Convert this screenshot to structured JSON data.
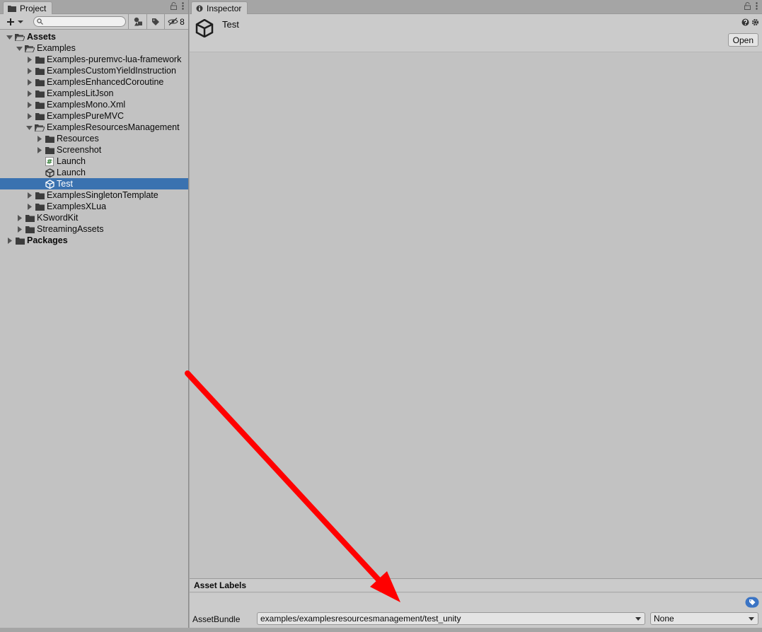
{
  "project": {
    "tab_label": "Project",
    "search_placeholder": "",
    "hidden_count": "8",
    "tree": [
      {
        "label": "Assets",
        "depth": 0,
        "arrow": "open",
        "icon": "folder-open",
        "bold": true
      },
      {
        "label": "Examples",
        "depth": 1,
        "arrow": "open",
        "icon": "folder-open"
      },
      {
        "label": "Examples-puremvc-lua-framework",
        "depth": 2,
        "arrow": "closed",
        "icon": "folder"
      },
      {
        "label": "ExamplesCustomYieldInstruction",
        "depth": 2,
        "arrow": "closed",
        "icon": "folder"
      },
      {
        "label": "ExamplesEnhancedCoroutine",
        "depth": 2,
        "arrow": "closed",
        "icon": "folder"
      },
      {
        "label": "ExamplesLitJson",
        "depth": 2,
        "arrow": "closed",
        "icon": "folder"
      },
      {
        "label": "ExamplesMono.Xml",
        "depth": 2,
        "arrow": "closed",
        "icon": "folder"
      },
      {
        "label": "ExamplesPureMVC",
        "depth": 2,
        "arrow": "closed",
        "icon": "folder"
      },
      {
        "label": "ExamplesResourcesManagement",
        "depth": 2,
        "arrow": "open",
        "icon": "folder-open"
      },
      {
        "label": "Resources",
        "depth": 3,
        "arrow": "closed",
        "icon": "folder"
      },
      {
        "label": "Screenshot",
        "depth": 3,
        "arrow": "closed",
        "icon": "folder"
      },
      {
        "label": "Launch",
        "depth": 3,
        "arrow": "none",
        "icon": "csharp"
      },
      {
        "label": "Launch",
        "depth": 3,
        "arrow": "none",
        "icon": "unity"
      },
      {
        "label": "Test",
        "depth": 3,
        "arrow": "none",
        "icon": "unity",
        "selected": true
      },
      {
        "label": "ExamplesSingletonTemplate",
        "depth": 2,
        "arrow": "closed",
        "icon": "folder"
      },
      {
        "label": "ExamplesXLua",
        "depth": 2,
        "arrow": "closed",
        "icon": "folder"
      },
      {
        "label": "KSwordKit",
        "depth": 1,
        "arrow": "closed",
        "icon": "folder"
      },
      {
        "label": "StreamingAssets",
        "depth": 1,
        "arrow": "closed",
        "icon": "folder"
      },
      {
        "label": "Packages",
        "depth": 0,
        "arrow": "closed",
        "icon": "folder",
        "bold": true
      }
    ]
  },
  "inspector": {
    "tab_label": "Inspector",
    "asset_title": "Test",
    "open_label": "Open",
    "asset_labels_heading": "Asset Labels",
    "asset_bundle_label": "AssetBundle",
    "asset_bundle_value": "examples/examplesresourcesmanagement/test_unity",
    "variant_value": "None"
  },
  "colors": {
    "selection": "#3a72b0",
    "annotation_arrow": "#ff0000",
    "tag_icon": "#3b74c4"
  },
  "annotation": {
    "type": "arrow",
    "from": "asset-bundle-area-top-left",
    "to": "asset-bundle-dropdown"
  }
}
